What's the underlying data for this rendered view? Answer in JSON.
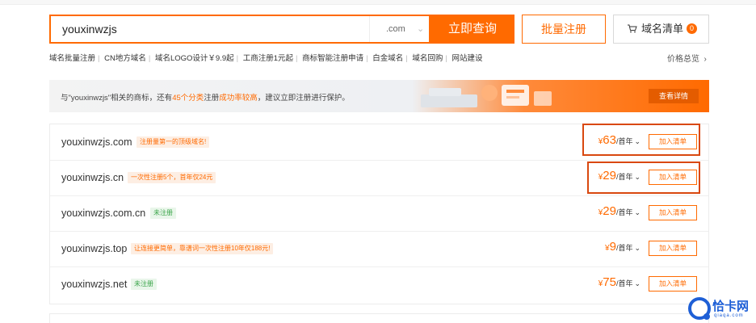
{
  "search": {
    "value": "youxinwzjs",
    "tld": ".com",
    "query_label": "立即查询",
    "bulk_label": "批量注册",
    "cart_label": "域名清单",
    "cart_count": "0"
  },
  "quick_links": [
    "域名批量注册",
    "CN地方域名",
    "域名LOGO设计￥9.9起",
    "工商注册1元起",
    "商标智能注册申请",
    "白金域名",
    "域名回购",
    "网站建设"
  ],
  "price_overview": "价格总览",
  "banner": {
    "text_prefix": "与\"youxinwzjs\"相关的商标，还有",
    "text_hl1": "45个分类",
    "text_mid": "注册",
    "text_hl2": "成功率较高",
    "text_suffix": "，建议立即注册进行保护。",
    "button": "查看详情"
  },
  "results": [
    {
      "domain": "youxinwzjs.com",
      "tag": "注册量第一的顶级域名!",
      "tag_style": "orange",
      "currency": "¥",
      "price": "63",
      "unit": "/首年",
      "add": "加入清单"
    },
    {
      "domain": "youxinwzjs.cn",
      "tag": "一次性注册5个，首年仅24元",
      "tag_style": "orange",
      "currency": "¥",
      "price": "29",
      "unit": "/首年",
      "add": "加入清单"
    },
    {
      "domain": "youxinwzjs.com.cn",
      "tag": "未注册",
      "tag_style": "green",
      "currency": "¥",
      "price": "29",
      "unit": "/首年",
      "add": "加入清单"
    },
    {
      "domain": "youxinwzjs.top",
      "tag": "让连接更简单，靠谱词一次性注册10年仅188元!",
      "tag_style": "orange",
      "currency": "¥",
      "price": "9",
      "unit": "/首年",
      "add": "加入清单"
    },
    {
      "domain": "youxinwzjs.net",
      "tag": "未注册",
      "tag_style": "green",
      "currency": "¥",
      "price": "75",
      "unit": "/首年",
      "add": "加入清单"
    }
  ],
  "watermark": {
    "text": "恰卡网",
    "sub": "qiaqa.com"
  },
  "colors": {
    "accent": "#ff6a00",
    "highlight": "#d9480f",
    "success": "#3aa54a"
  }
}
